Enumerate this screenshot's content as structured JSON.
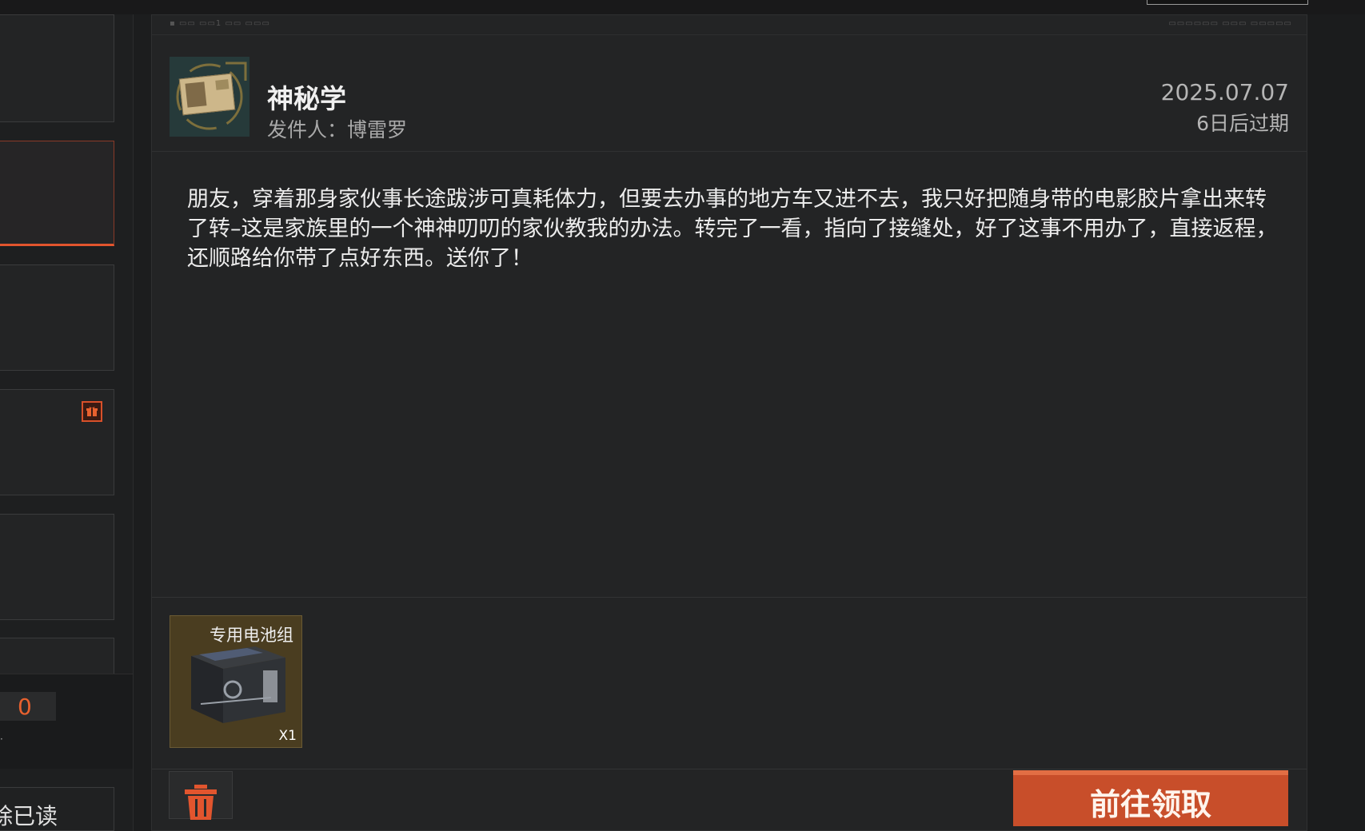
{
  "strip": {
    "left_text": "▪ ▭▭  ▭▭1  ▭▭ ▭▭▭",
    "right_text": "▭▭▭▭▭▭  ▭▭▭ ▭▭▭▭▭"
  },
  "mail": {
    "title": "神秘学",
    "sender": "发件人：博雷罗",
    "date": "2025.07.07",
    "expires": "6日后过期",
    "body": "朋友，穿着那身家伙事长途跋涉可真耗体力，但要去办事的地方车又进不去，我只好把随身带的电影胶片拿出来转了转–这是家族里的一个神神叨叨的家伙教我的办法。转完了一看，指向了接缝处，好了这事不用办了，直接返程，还顺路给你带了点好东西。送你了！"
  },
  "attachment": {
    "name": "专用电池组",
    "quantity": "X1"
  },
  "left_panel": {
    "counter_value": "0",
    "counter_dot": "·",
    "delete_read_label": "除已读"
  },
  "actions": {
    "claim_label": "前往领取"
  },
  "colors": {
    "accent": "#e2552e",
    "button": "#c84e2a",
    "background": "#1c1d1e",
    "panel": "#232425"
  },
  "icons": {
    "gift": "gift-icon",
    "trash": "trash-icon"
  }
}
